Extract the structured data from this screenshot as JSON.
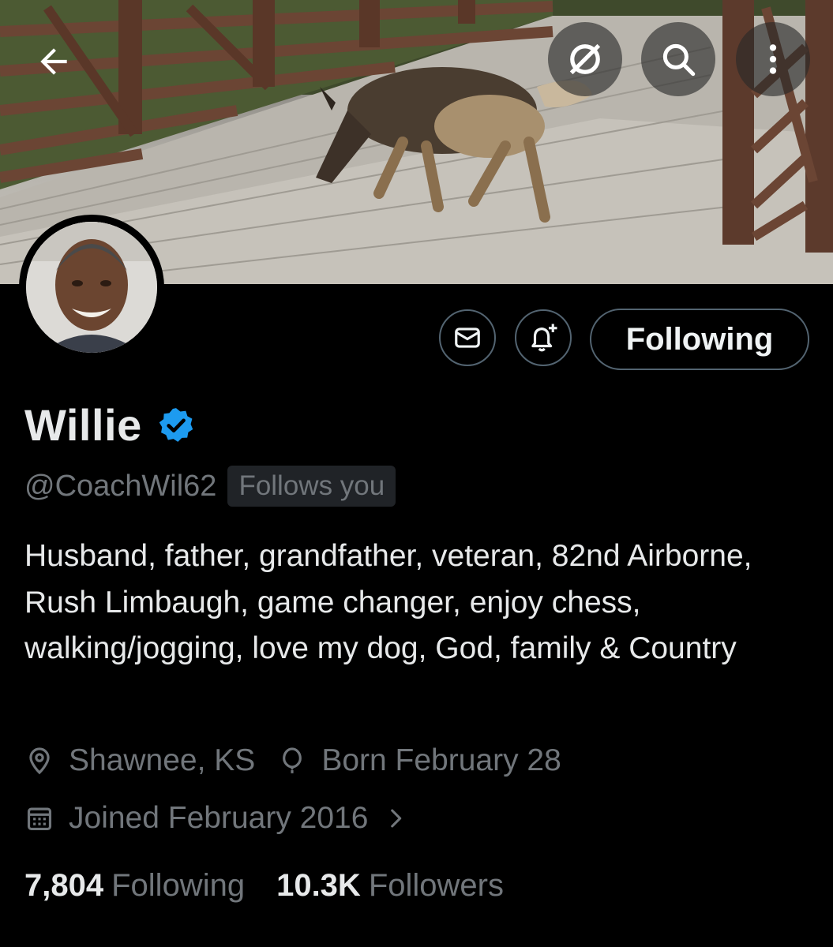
{
  "profile": {
    "name": "Willie",
    "handle": "@CoachWil62",
    "follows_you": "Follows you",
    "bio": "Husband, father, grandfather, veteran, 82nd Airborne, Rush Limbaugh, game changer, enjoy chess, walking/jogging, love my dog, God, family & Country",
    "location": "Shawnee, KS",
    "birthday": "Born February 28",
    "joined": "Joined February 2016"
  },
  "actions": {
    "follow_label": "Following"
  },
  "stats": {
    "following_count": "7,804",
    "following_label": "Following",
    "followers_count": "10.3K",
    "followers_label": "Followers"
  },
  "icons": {
    "back": "arrow-left-icon",
    "grok": "grok-icon",
    "search": "search-icon",
    "more": "more-vertical-icon",
    "message": "envelope-icon",
    "notify": "bell-plus-icon",
    "verified": "verified-badge-icon",
    "location": "location-pin-icon",
    "birthday": "balloon-icon",
    "calendar": "calendar-icon",
    "chevron": "chevron-right-icon"
  },
  "colors": {
    "background": "#000000",
    "text_primary": "#e7e9ea",
    "text_secondary": "#71767b",
    "border": "#536471",
    "verified_blue": "#1d9bf0"
  }
}
